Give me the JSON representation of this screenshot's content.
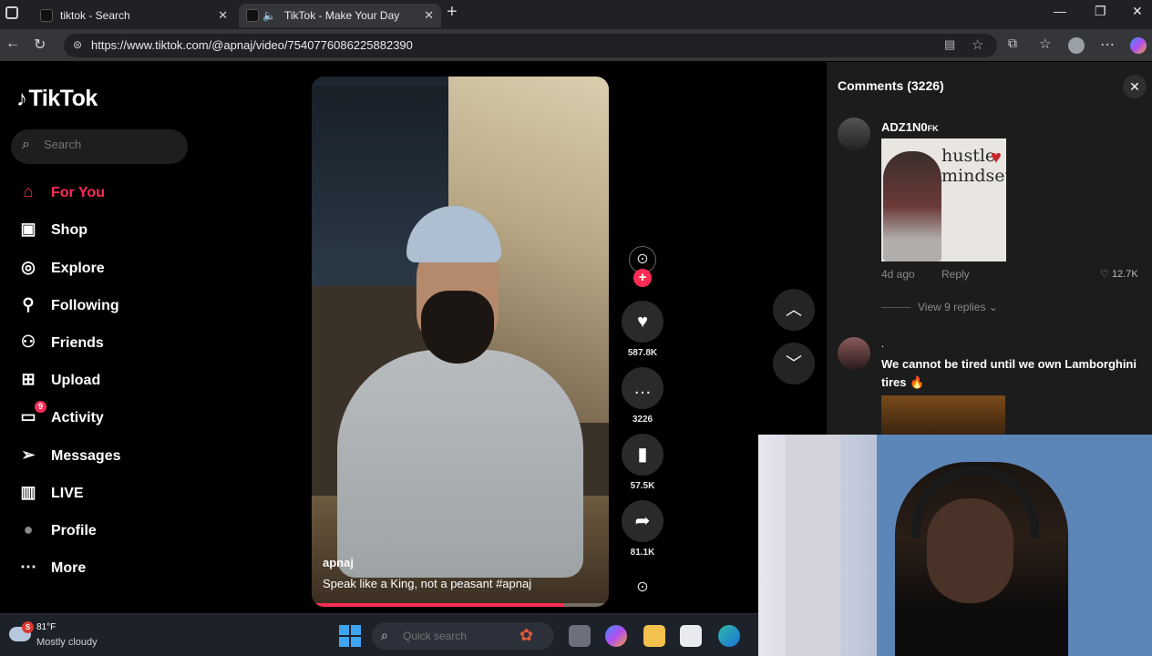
{
  "browser": {
    "tabs": [
      {
        "title": "tiktok - Search",
        "active": false
      },
      {
        "title": "TikTok - Make Your Day",
        "active": true
      }
    ],
    "url": "https://www.tiktok.com/@apnaj/video/7540776086225882390"
  },
  "sidebar": {
    "logo": "TikTok",
    "search_placeholder": "Search",
    "items": [
      {
        "label": "For You",
        "icon": "home-icon",
        "active": true
      },
      {
        "label": "Shop",
        "icon": "shop-bag-icon"
      },
      {
        "label": "Explore",
        "icon": "compass-icon"
      },
      {
        "label": "Following",
        "icon": "following-user-icon"
      },
      {
        "label": "Friends",
        "icon": "friends-icon"
      },
      {
        "label": "Upload",
        "icon": "upload-plus-icon"
      },
      {
        "label": "Activity",
        "icon": "activity-message-icon",
        "badge": "9"
      },
      {
        "label": "Messages",
        "icon": "paper-plane-icon"
      },
      {
        "label": "LIVE",
        "icon": "live-tv-icon"
      },
      {
        "label": "Profile",
        "icon": "profile-avatar-icon"
      },
      {
        "label": "More",
        "icon": "more-dots-icon"
      }
    ]
  },
  "video": {
    "username": "apnaj",
    "caption": "Speak like a King, not a peasant #apnaj",
    "progress_percent": 85
  },
  "actions": {
    "likes": "587.8K",
    "comments": "3226",
    "saves": "57.5K",
    "shares": "81.1K"
  },
  "comments": {
    "title": "Comments (3226)",
    "items": [
      {
        "username": "ADZ1N0",
        "username_suffix": "FK",
        "image_text_line1": "hustle",
        "image_text_line2": "mindset",
        "age": "4d ago",
        "reply_label": "Reply",
        "likes": "12.7K",
        "view_replies": "View 9 replies"
      },
      {
        "username": ".",
        "text": "We cannot be tired until we own Lamborghini tires 🔥"
      }
    ]
  },
  "taskbar": {
    "weather_temp": "81°F",
    "weather_desc": "Mostly cloudy",
    "weather_badge": "S",
    "search_placeholder": "Quick search"
  },
  "colors": {
    "accent": "#fe2c55",
    "background": "#000000",
    "panel": "#1c1c1c"
  }
}
